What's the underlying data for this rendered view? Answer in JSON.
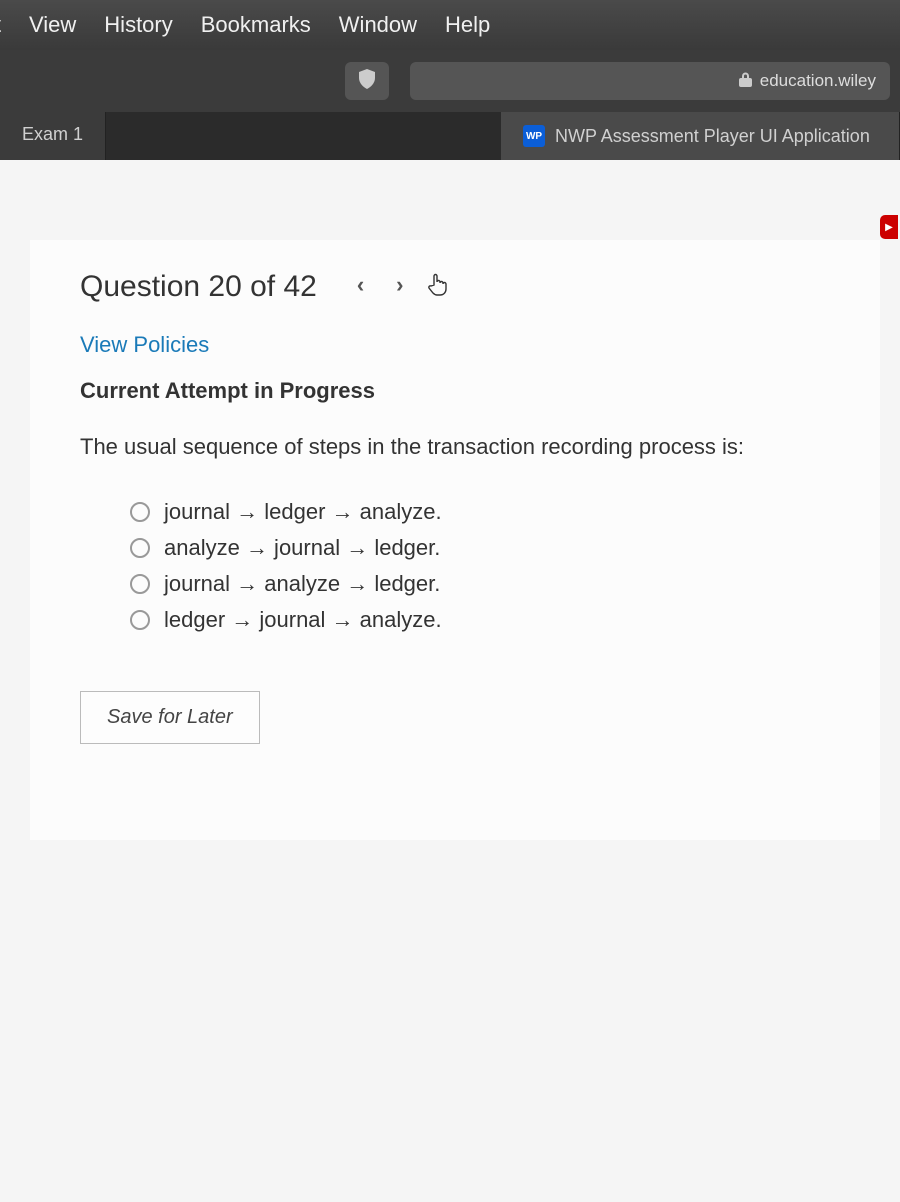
{
  "menubar": {
    "items": [
      "it",
      "View",
      "History",
      "Bookmarks",
      "Window",
      "Help"
    ]
  },
  "browser": {
    "address_domain": "education.wiley",
    "tabs": {
      "inactive_label": "Exam 1",
      "active_favicon": "WP",
      "active_label": "NWP Assessment Player UI Application"
    }
  },
  "question": {
    "header": "Question 20 of 42",
    "policies_link": "View Policies",
    "attempt_heading": "Current Attempt in Progress",
    "prompt": "The usual sequence of steps in the transaction recording process is:",
    "options": [
      "journal → ledger → analyze.",
      "analyze → journal → ledger.",
      "journal → analyze → ledger.",
      "ledger → journal → analyze."
    ],
    "save_button": "Save for Later"
  }
}
